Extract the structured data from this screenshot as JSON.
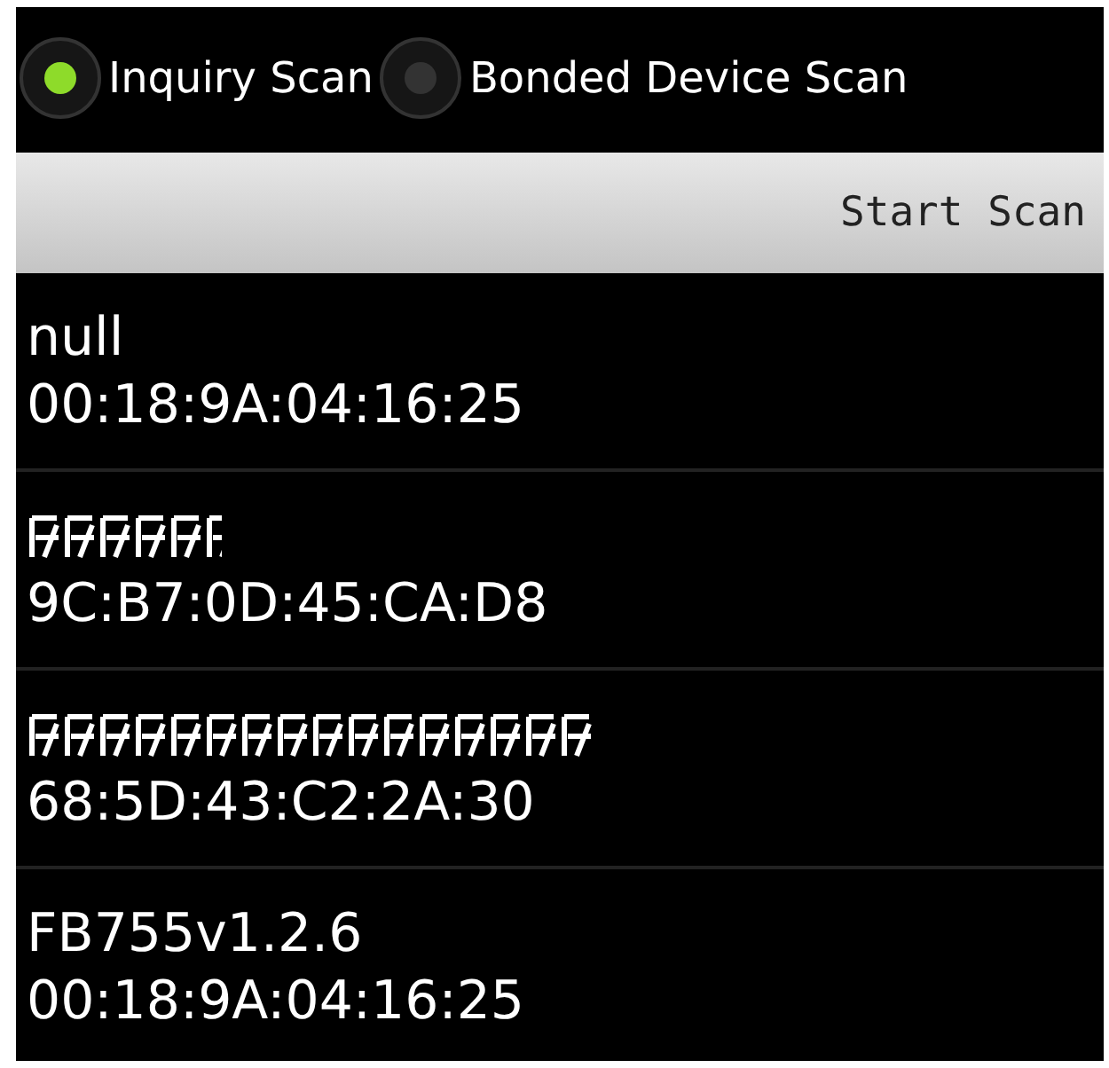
{
  "scan_modes": [
    {
      "label": "Inquiry Scan",
      "selected": true
    },
    {
      "label": "Bonded Device Scan",
      "selected": false
    }
  ],
  "start_button": {
    "label": "Start Scan"
  },
  "devices": [
    {
      "kind": "text",
      "name": "null",
      "address": "00:18:9A:04:16:25"
    },
    {
      "kind": "redacted",
      "address": "9C:B7:0D:45:CA:D8"
    },
    {
      "kind": "redacted",
      "address": "68:5D:43:C2:2A:30"
    },
    {
      "kind": "text",
      "name": "FB755v1.2.6",
      "address": "00:18:9A:04:16:25"
    }
  ]
}
